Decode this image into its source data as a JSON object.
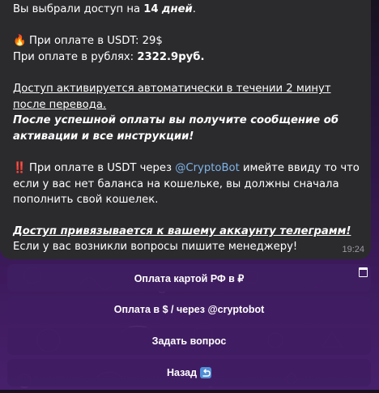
{
  "message": {
    "line1_prefix": "Вы выбрали доступ на ",
    "line1_days": "14",
    "line1_days_word": "дней",
    "line1_suffix": ".",
    "fire_emoji": "🔥",
    "usdt_price": "При оплате в USDT: 29$",
    "rub_price_label": "При оплате в рублях: ",
    "rub_price_value": "2322.9руб.",
    "activation_line1": "Доступ активируется автоматически в течении 2 минут ",
    "activation_line2": "после перевода.",
    "after_payment_line1": "После успешной оплаты вы получите сообщение об",
    "after_payment_line2": "активации и все инструкции!",
    "warning_emoji": "‼️",
    "usdt_note_prefix": "При оплате в USDT через ",
    "cryptobot_link": "@CryptoBot",
    "usdt_note_suffix": " имейте ввиду то что",
    "usdt_note_line2": "если у вас нет баланса на кошельке, вы должны сначала",
    "usdt_note_line3": "пополнить свой кошелек.",
    "binding_note": "Доступ привязывается к вашему аккаунту телеграмм!",
    "questions_note": "Если у вас возникли вопросы пишите менеджеру!",
    "time": "19:24"
  },
  "buttons": {
    "card_rf": "Оплата картой РФ в ₽",
    "crypto": "Оплата в $ / через @cryptobot",
    "ask": "Задать вопрос",
    "back": "Назад"
  },
  "colors": {
    "bubble": "#2b2b2e",
    "button": "#401e62",
    "link": "#7fb4e8",
    "back_icon": "#4f8fd6"
  },
  "icons": {
    "corner": "bot-keyboard-icon",
    "back": "back-arrow-icon"
  }
}
